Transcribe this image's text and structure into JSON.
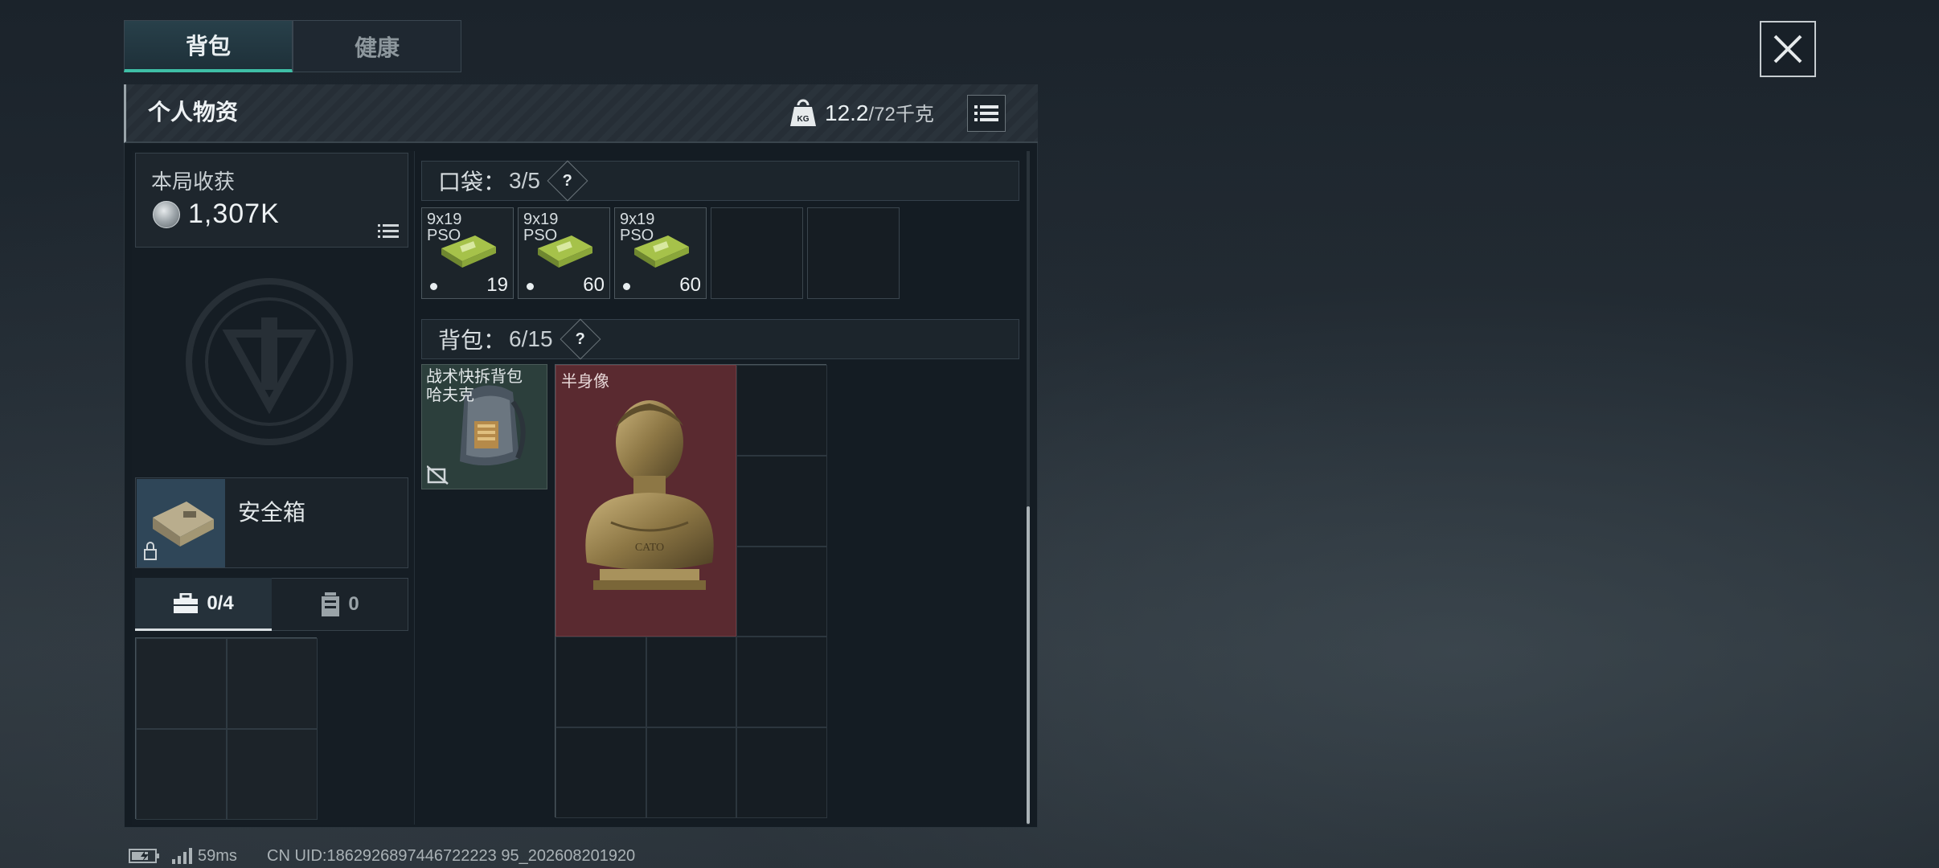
{
  "tabs": [
    {
      "label": "背包",
      "active": true
    },
    {
      "label": "健康",
      "active": false
    }
  ],
  "header": {
    "title": "个人物资",
    "weight_current": "12.2",
    "weight_max": "/72千克",
    "weight_icon": "kg-weight-icon"
  },
  "earnings": {
    "title": "本局收获",
    "value": "1,307K"
  },
  "safe": {
    "label": "安全箱"
  },
  "slot_tabs": [
    {
      "label": "0/4",
      "icon": "briefcase-icon"
    },
    {
      "label": "0",
      "icon": "canister-icon"
    }
  ],
  "pocket": {
    "label": "口袋：",
    "count": "3/5",
    "help": "?",
    "items": [
      {
        "name": "9x19\nPSO",
        "count": "19"
      },
      {
        "name": "9x19\nPSO",
        "count": "60"
      },
      {
        "name": "9x19\nPSO",
        "count": "60"
      }
    ]
  },
  "backpack": {
    "label": "背包：",
    "count": "6/15",
    "help": "?",
    "items": [
      {
        "name": "战术快拆背包\n哈夫克"
      },
      {
        "name": "半身像"
      }
    ]
  },
  "status_bar": {
    "ping": "59ms",
    "uid": "CN UID:1862926897446722223 95_202608201920"
  },
  "colors": {
    "accent": "#3fbfa6",
    "bust_bg": "#5a2a30",
    "panel_bg": "#141c23"
  }
}
